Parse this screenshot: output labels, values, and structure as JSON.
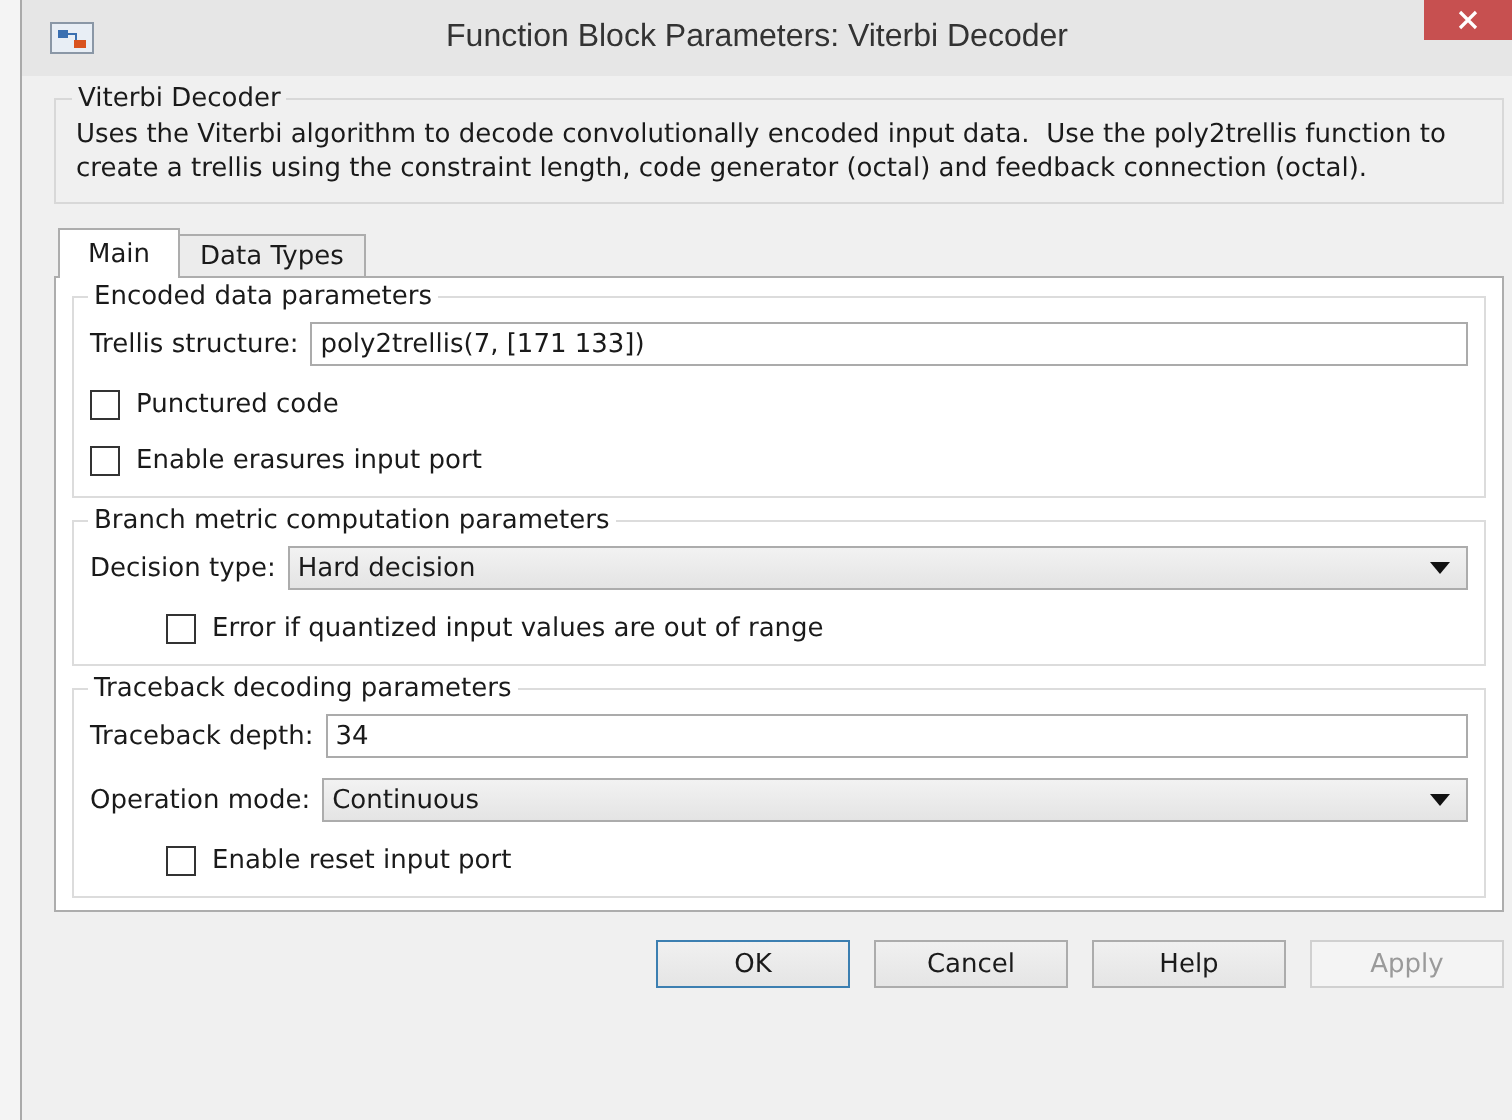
{
  "window": {
    "title": "Function Block Parameters: Viterbi Decoder"
  },
  "description": {
    "title": "Viterbi Decoder",
    "text": "Uses the Viterbi algorithm to decode convolutionally encoded input data.  Use the poly2trellis function to create a trellis using the constraint length, code generator (octal) and feedback connection (octal)."
  },
  "tabs": [
    {
      "label": "Main",
      "selected": true
    },
    {
      "label": "Data Types",
      "selected": false
    }
  ],
  "groups": [
    {
      "title": "Encoded data parameters",
      "items": [
        {
          "kind": "field",
          "label": "Trellis structure:",
          "value": "poly2trellis(7, [171 133])"
        },
        {
          "kind": "checkbox",
          "label": "Punctured code",
          "checked": false,
          "indented": false
        },
        {
          "kind": "checkbox",
          "label": "Enable erasures input port",
          "checked": false,
          "indented": false
        }
      ]
    },
    {
      "title": "Branch metric computation parameters",
      "items": [
        {
          "kind": "dropdown",
          "label": "Decision type:",
          "value": "Hard decision"
        },
        {
          "kind": "checkbox",
          "label": "Error if quantized input values are out of range",
          "checked": false,
          "indented": true
        }
      ]
    },
    {
      "title": "Traceback decoding parameters",
      "items": [
        {
          "kind": "field",
          "label": "Traceback depth:",
          "value": "34"
        },
        {
          "kind": "dropdown",
          "label": "Operation mode:",
          "value": "Continuous"
        },
        {
          "kind": "checkbox",
          "label": "Enable reset input port",
          "checked": false,
          "indented": true
        }
      ]
    }
  ],
  "buttons": [
    {
      "label": "OK",
      "disabled": false
    },
    {
      "label": "Cancel",
      "disabled": false
    },
    {
      "label": "Help",
      "disabled": false
    },
    {
      "label": "Apply",
      "disabled": true
    }
  ]
}
